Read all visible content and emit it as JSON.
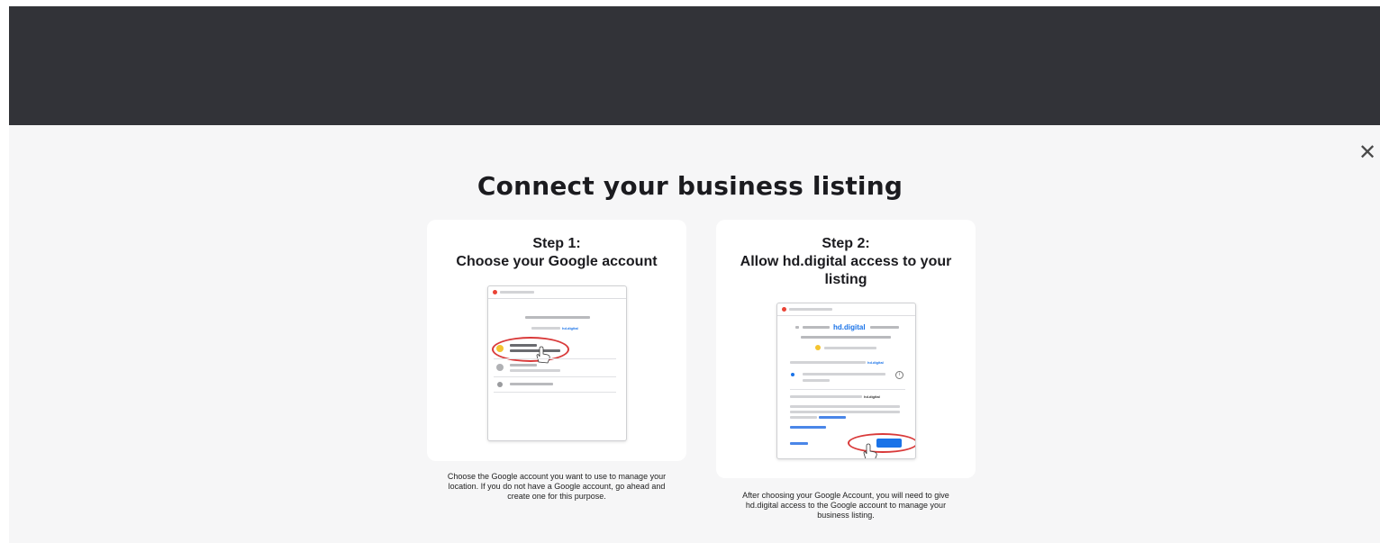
{
  "modal": {
    "title": "Connect your business listing",
    "close_glyph": "✕"
  },
  "steps": [
    {
      "heading_line1": "Step 1:",
      "heading_line2": "Choose your Google account",
      "description": "Choose the Google account you want to use to manage your location. If you do not have a Google account, go ahead and create one for this purpose.",
      "illustration": {
        "brand_text": "hd.digital"
      }
    },
    {
      "heading_line1": "Step 2:",
      "heading_line2": "Allow hd.digital access to your listing",
      "description": "After choosing your Google Account, you will need to give hd.digital access to the Google account to manage your business listing.",
      "illustration": {
        "brand_text_large": "hd.digital",
        "brand_text_small": "hd.digital",
        "brand_text_small_2": "hd.digital"
      }
    }
  ],
  "colors": {
    "topbar": "#323338",
    "background": "#f6f6f7",
    "card": "#ffffff",
    "google_blue": "#1a73e8",
    "highlight_red": "#d93a3a"
  }
}
